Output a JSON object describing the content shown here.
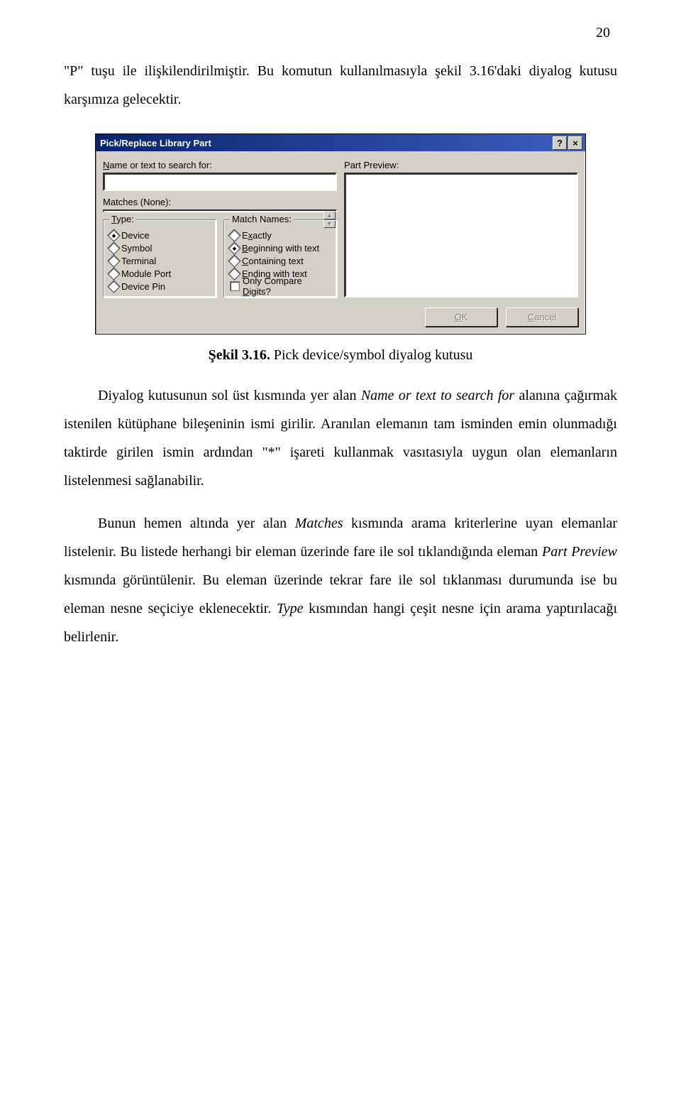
{
  "page_number": "20",
  "para1_a": "\"P\" tuşu ile ilişkilendirilmiştir. Bu komutun kullanılmasıyla şekil 3.16'daki diyalog kutusu karşımıza gelecektir.",
  "caption_bold": "Şekil 3.16.",
  "caption_rest": " Pick device/symbol diyalog kutusu",
  "para2_a": "Diyalog kutusunun sol üst kısmında yer alan ",
  "para2_i1": "Name or text to search for",
  "para2_b": " alanına çağırmak istenilen kütüphane bileşeninin ismi girilir. Aranılan elemanın tam isminden emin olunmadığı taktirde girilen ismin ardından \"*\" işareti kullanmak vasıtasıyla uygun olan elemanların listelenmesi sağlanabilir.",
  "para3_a": "Bunun hemen altında yer alan ",
  "para3_i1": "Matches",
  "para3_b": " kısmında arama kriterlerine uyan elemanlar listelenir. Bu listede herhangi bir eleman üzerinde fare ile sol tıklandığında eleman ",
  "para3_i2": "Part Preview",
  "para3_c": " kısmında görüntülenir. Bu eleman üzerinde tekrar fare ile sol tıklanması durumunda ise bu eleman nesne seçiciye eklenecektir. ",
  "para3_i3": "Type",
  "para3_d": " kısmından hangi çeşit nesne için arama yaptırılacağı belirlenir.",
  "dialog": {
    "title": "Pick/Replace Library Part",
    "help": "?",
    "close": "×",
    "name_label_pre": "",
    "name_label_u": "N",
    "name_label_post": "ame or text to search for:",
    "matches_label": "Matches (None):",
    "preview_label": "Part Preview:",
    "type_legend_u": "T",
    "type_legend_post": "ype:",
    "types": [
      {
        "label": "Device",
        "sel": true
      },
      {
        "label": "Symbol",
        "sel": false
      },
      {
        "label": "Terminal",
        "sel": false
      },
      {
        "label": "Module Port",
        "sel": false
      },
      {
        "label": "Device Pin",
        "sel": false
      }
    ],
    "match_legend": "Match Names:",
    "match_opts": [
      {
        "pre": "E",
        "u": "x",
        "post": "actly",
        "sel": false,
        "type": "radio"
      },
      {
        "pre": "",
        "u": "B",
        "post": "eginning with text",
        "sel": true,
        "type": "radio"
      },
      {
        "pre": "",
        "u": "C",
        "post": "ontaining text",
        "sel": false,
        "type": "radio"
      },
      {
        "pre": "",
        "u": "E",
        "post": "nding with text",
        "sel": false,
        "type": "radio"
      },
      {
        "pre": "Only Compare ",
        "u": "D",
        "post": "igits?",
        "sel": false,
        "type": "check"
      }
    ],
    "ok_u": "O",
    "ok_post": "K",
    "cancel_u": "C",
    "cancel_post": "ancel"
  }
}
